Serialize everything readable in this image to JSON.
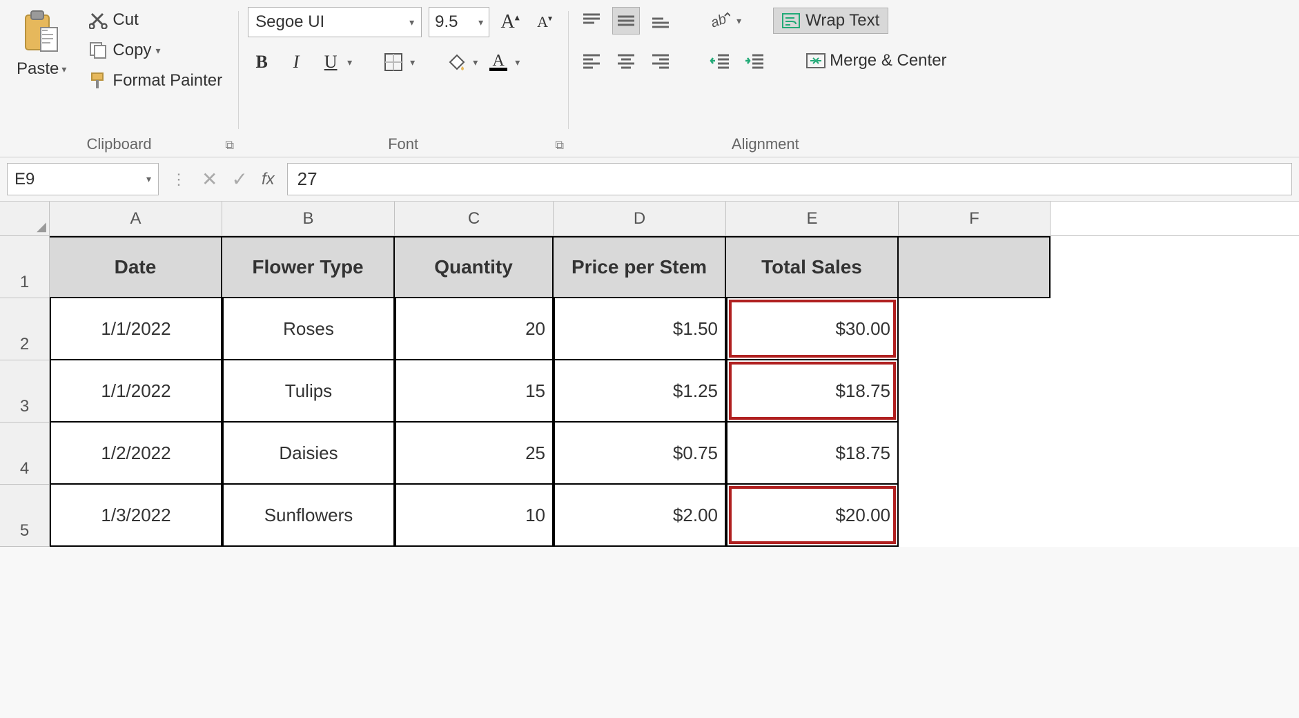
{
  "ribbon": {
    "clipboard": {
      "paste": "Paste",
      "cut": "Cut",
      "copy": "Copy",
      "format_painter": "Format Painter",
      "label": "Clipboard"
    },
    "font": {
      "name": "Segoe UI",
      "size": "9.5",
      "label": "Font"
    },
    "alignment": {
      "wrap_text": "Wrap Text",
      "merge_center": "Merge & Center",
      "label": "Alignment"
    }
  },
  "formula_bar": {
    "cell_ref": "E9",
    "formula": "27",
    "fx": "fx"
  },
  "columns": [
    "A",
    "B",
    "C",
    "D",
    "E",
    "F"
  ],
  "rows": [
    "1",
    "2",
    "3",
    "4",
    "5"
  ],
  "headers": [
    "Date",
    "Flower Type",
    "Quantity",
    "Price per Stem",
    "Total Sales"
  ],
  "data": [
    {
      "date": "1/1/2022",
      "type": "Roses",
      "qty": "20",
      "price": "$1.50",
      "total": "$30.00",
      "highlight": true
    },
    {
      "date": "1/1/2022",
      "type": "Tulips",
      "qty": "15",
      "price": "$1.25",
      "total": "$18.75",
      "highlight": true
    },
    {
      "date": "1/2/2022",
      "type": "Daisies",
      "qty": "25",
      "price": "$0.75",
      "total": "$18.75",
      "highlight": false
    },
    {
      "date": "1/3/2022",
      "type": "Sunflowers",
      "qty": "10",
      "price": "$2.00",
      "total": "$20.00",
      "highlight": true
    }
  ]
}
